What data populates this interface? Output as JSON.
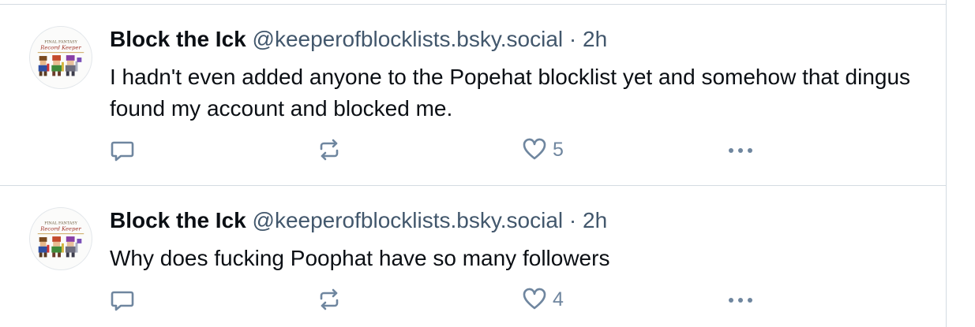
{
  "posts": [
    {
      "display_name": "Block the Ick",
      "handle": "@keeperofblocklists.bsky.social",
      "separator": "·",
      "time": "2h",
      "text": "I hadn't even added anyone to the Popehat blocklist yet and somehow that dingus found my account and blocked me.",
      "like_count": "5",
      "avatar_caption_line1": "FINAL FANTASY",
      "avatar_caption_line2": "Record Keeper"
    },
    {
      "display_name": "Block the Ick",
      "handle": "@keeperofblocklists.bsky.social",
      "separator": "·",
      "time": "2h",
      "text": "Why does fucking Poophat have so many followers",
      "like_count": "4",
      "avatar_caption_line1": "FINAL FANTASY",
      "avatar_caption_line2": "Record Keeper"
    }
  ],
  "icons": {
    "reply": "reply-icon",
    "repost": "repost-icon",
    "like": "heart-icon",
    "more": "more-icon"
  },
  "colors": {
    "text": "#0b0f14",
    "secondary": "#42576c",
    "icon": "#6f869f",
    "divider": "#d4dbe2"
  }
}
